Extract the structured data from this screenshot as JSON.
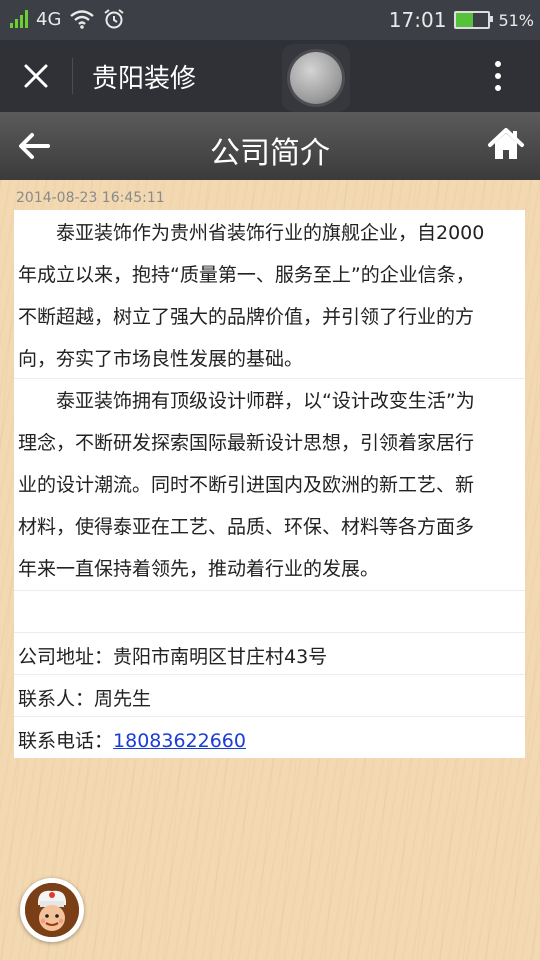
{
  "status": {
    "network": "4G",
    "time": "17:01",
    "battery": "51%",
    "battery_level": 0.51,
    "icons": [
      "signal-icon",
      "wifi-icon",
      "alarm-icon",
      "battery-icon"
    ]
  },
  "navbar": {
    "title": "贵阳装修",
    "icons": [
      "close-icon",
      "menu-dots-icon",
      "floating-ball-icon"
    ]
  },
  "header": {
    "title": "公司简介",
    "icons": [
      "back-arrow-icon",
      "home-icon"
    ]
  },
  "article": {
    "date": "2014-08-23 16:45:11",
    "lines_p1": [
      "泰亚装饰作为贵州省装饰行业的旗舰企业，自2000",
      "年成立以来，抱持“质量第一、服务至上”的企业信条，",
      "不断超越，树立了强大的品牌价值，并引领了行业的方",
      "向，夯实了市场良性发展的基础。"
    ],
    "lines_p2": [
      "泰亚装饰拥有顶级设计师群，以“设计改变生活”为",
      "理念，不断研发探索国际最新设计思想，引领着家居行",
      "业的设计潮流。同时不断引进国内及欧洲的新工艺、新",
      "材料，使得泰亚在工艺、品质、环保、材料等各方面多",
      "年来一直保持着领先，推动着行业的发展。"
    ],
    "address": "公司地址：贵阳市南明区甘庄村43号",
    "contact": "联系人：周先生",
    "phone_label": "联系电话：",
    "phone": "18083622660"
  },
  "colors": {
    "statusbar": "#3c3f45",
    "navbar": "#2f3136",
    "header": "#4a4a4a",
    "wood": "#f3d9b2",
    "link": "#1a3dd6"
  }
}
